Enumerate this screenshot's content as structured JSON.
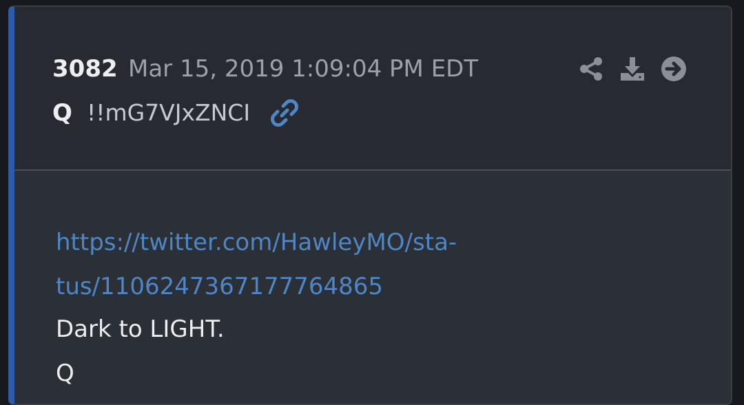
{
  "post": {
    "number": "3082",
    "date": "Mar 15, 2019 1:09:04 PM EDT",
    "author": "Q",
    "tripcode": "!!mG7VJxZNCI",
    "link_line_1": "https://twitter.com/HawleyMO/sta-",
    "link_line_2": "tus/1106247367177764865",
    "body_lines": [
      "Dark to LIGHT.",
      "Q"
    ]
  },
  "icons": {
    "author_link": "link-icon",
    "actions": [
      "share-icon",
      "download-icon",
      "arrow-right-icon"
    ]
  },
  "colors": {
    "accent_bar": "#2f5aa6",
    "link": "#4f86c6",
    "header_bg": "#272a30",
    "body_bg": "#2b2f36",
    "text": "#eceef1",
    "muted": "#9da2a9"
  }
}
